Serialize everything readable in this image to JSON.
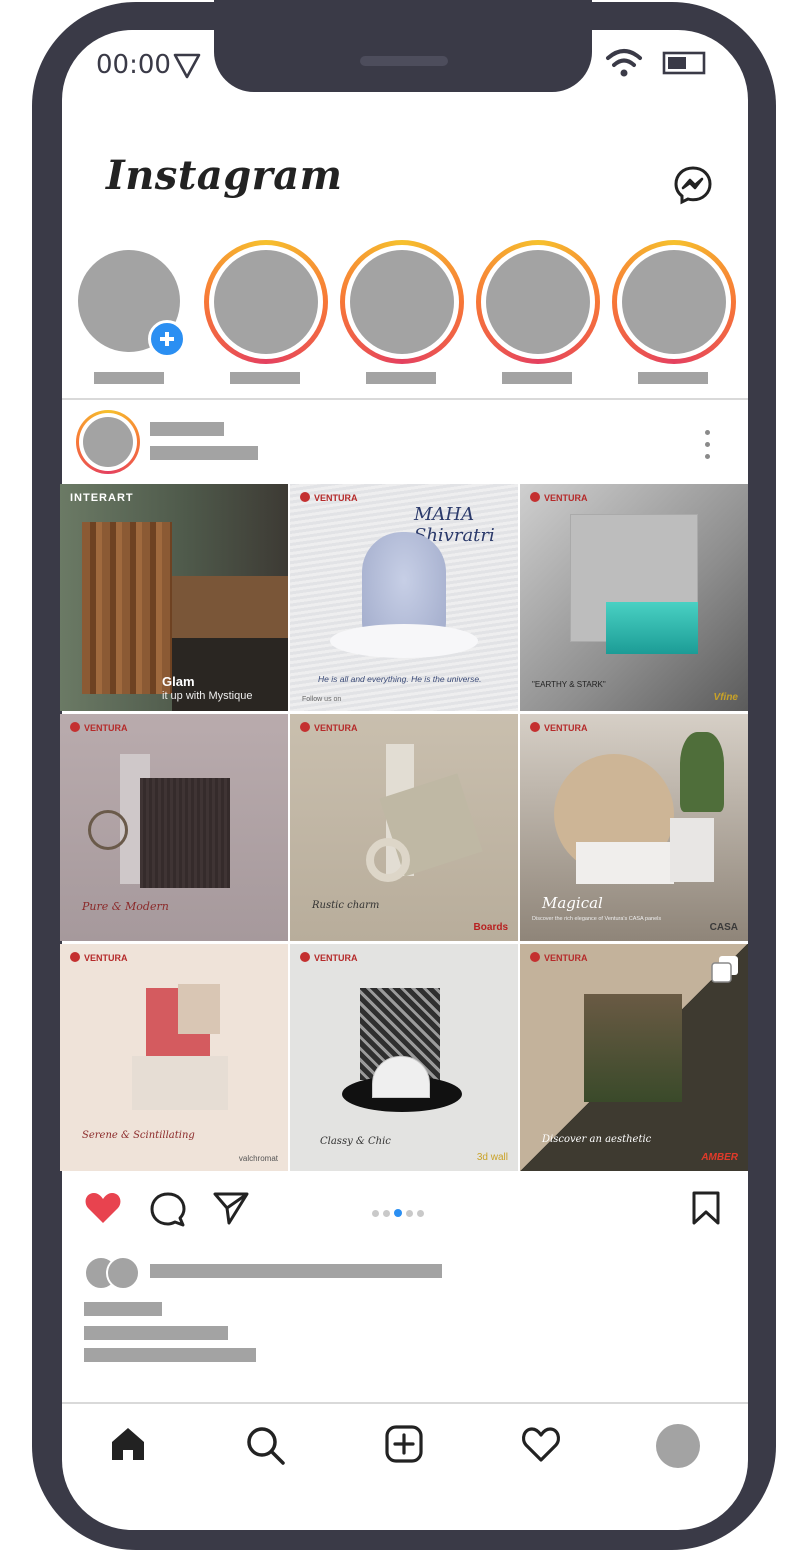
{
  "status_bar": {
    "time": "00:00"
  },
  "header": {
    "logo_text": "Instagram"
  },
  "colors": {
    "phone_frame": "#3a3a47",
    "placeholder_gray": "#a3a3a3",
    "story_ring_start": "#f6c12d",
    "story_ring_end": "#e4405f",
    "like_red": "#e8434f",
    "accent_blue": "#2b8ff2"
  },
  "icons": {
    "status": [
      "location-arrow-icon",
      "wifi-icon",
      "battery-icon"
    ],
    "header": [
      "messenger-icon"
    ],
    "post": [
      "more-icon",
      "heart-icon",
      "comment-icon",
      "share-icon",
      "bookmark-icon",
      "multi-image-icon"
    ],
    "tab_bar": [
      "home-icon",
      "search-icon",
      "new-post-icon",
      "activity-icon",
      "profile-avatar"
    ]
  },
  "post": {
    "liked": true,
    "carousel_dots": 5,
    "carousel_active_index": 2
  },
  "grid": [
    {
      "brand": "INTERART",
      "title": "Glam",
      "subtitle": "it up with Mystique"
    },
    {
      "brand": "VENTURA",
      "title": "MAHA Shivratri",
      "caption": "He is all and everything. He is the universe.",
      "follow": "Follow us on"
    },
    {
      "brand": "VENTURA",
      "title": "\"EARTHY & STARK\"",
      "footer": "Vfine"
    },
    {
      "brand": "VENTURA",
      "title": "Pure & Modern"
    },
    {
      "brand": "VENTURA",
      "title": "Rustic charm",
      "footer": "Boards"
    },
    {
      "brand": "VENTURA",
      "title": "Magical",
      "caption": "Discover the rich elegance of Ventura's CASA panels",
      "footer": "CASA"
    },
    {
      "brand": "VENTURA",
      "title": "Serene & Scintillating",
      "footer": "valchromat"
    },
    {
      "brand": "VENTURA",
      "title": "Classy & Chic",
      "footer": "3d wall"
    },
    {
      "brand": "VENTURA",
      "title": "Discover an aesthetic",
      "footer": "AMBER"
    }
  ]
}
